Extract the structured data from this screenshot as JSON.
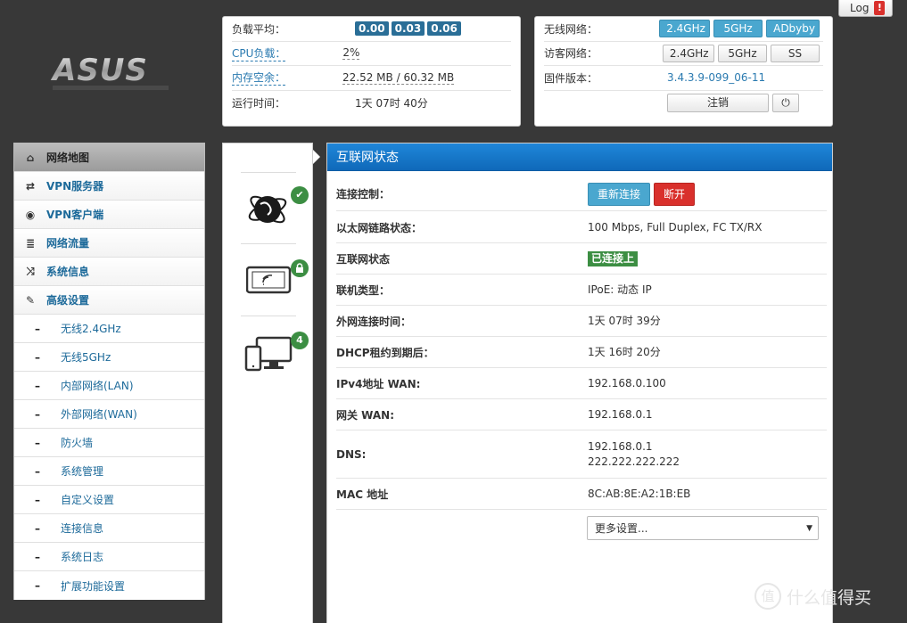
{
  "header": {
    "logo_text": "ASUS",
    "log_button": "Log",
    "log_alert": "!"
  },
  "system": {
    "load_label": "负载平均：",
    "load_values": [
      "0.00",
      "0.03",
      "0.06"
    ],
    "cpu_label": "CPU负载：",
    "cpu_value": "2%",
    "mem_label": "内存空余：",
    "mem_value": "22.52 MB / 60.32 MB",
    "uptime_label": "运行时间：",
    "uptime_value": "1天 07时 40分"
  },
  "wireless": {
    "wifi_label": "无线网络：",
    "wifi_buttons": [
      "2.4GHz",
      "5GHz",
      "ADbyby"
    ],
    "guest_label": "访客网络：",
    "guest_buttons": [
      "2.4GHz",
      "5GHz",
      "SS"
    ],
    "firmware_label": "固件版本：",
    "firmware_value": "3.4.3.9-099_06-11",
    "logout_label": "注销",
    "power_icon": "⏻"
  },
  "sidebar": {
    "items": [
      {
        "label": "网络地图",
        "icon": "⌂",
        "active": true
      },
      {
        "label": "VPN服务器",
        "icon": "⇄"
      },
      {
        "label": "VPN客户端",
        "icon": "◉"
      },
      {
        "label": "网络流量",
        "icon": "≣"
      },
      {
        "label": "系统信息",
        "icon": "⤨"
      },
      {
        "label": "高级设置",
        "icon": "✎"
      }
    ],
    "subitems": [
      "无线2.4GHz",
      "无线5GHz",
      "内部网络(LAN)",
      "外部网络(WAN)",
      "防火墙",
      "系统管理",
      "自定义设置",
      "连接信息",
      "系统日志",
      "扩展功能设置"
    ]
  },
  "map": {
    "internet_status": "✔",
    "wireless_status": "🔒",
    "clients_count": "4"
  },
  "internet": {
    "title": "互联网状态",
    "control_label": "连接控制：",
    "reconnect_button": "重新连接",
    "disconnect_button": "断开",
    "ethernet_label": "以太网链路状态：",
    "ethernet_value": "100 Mbps, Full Duplex, FC TX/RX",
    "status_label": "互联网状态",
    "status_value": "已连接上",
    "type_label": "联机类型：",
    "type_value": "IPoE: 动态 IP",
    "wan_time_label": "外网连接时间：",
    "wan_time_value": "1天 07时 39分",
    "dhcp_label": "DHCP租约到期后：",
    "dhcp_value": "1天 16时 20分",
    "ipv4_label": "IPv4地址 WAN:",
    "ipv4_value": "192.168.0.100",
    "gateway_label": "网关 WAN:",
    "gateway_value": "192.168.0.1",
    "dns_label": "DNS:",
    "dns_values": [
      "192.168.0.1",
      "222.222.222.222"
    ],
    "mac_label": "MAC 地址",
    "mac_value": "8C:AB:8E:A2:1B:EB",
    "more_settings": "更多设置..."
  },
  "watermark": {
    "text": "什么值得买",
    "icon": "值"
  }
}
